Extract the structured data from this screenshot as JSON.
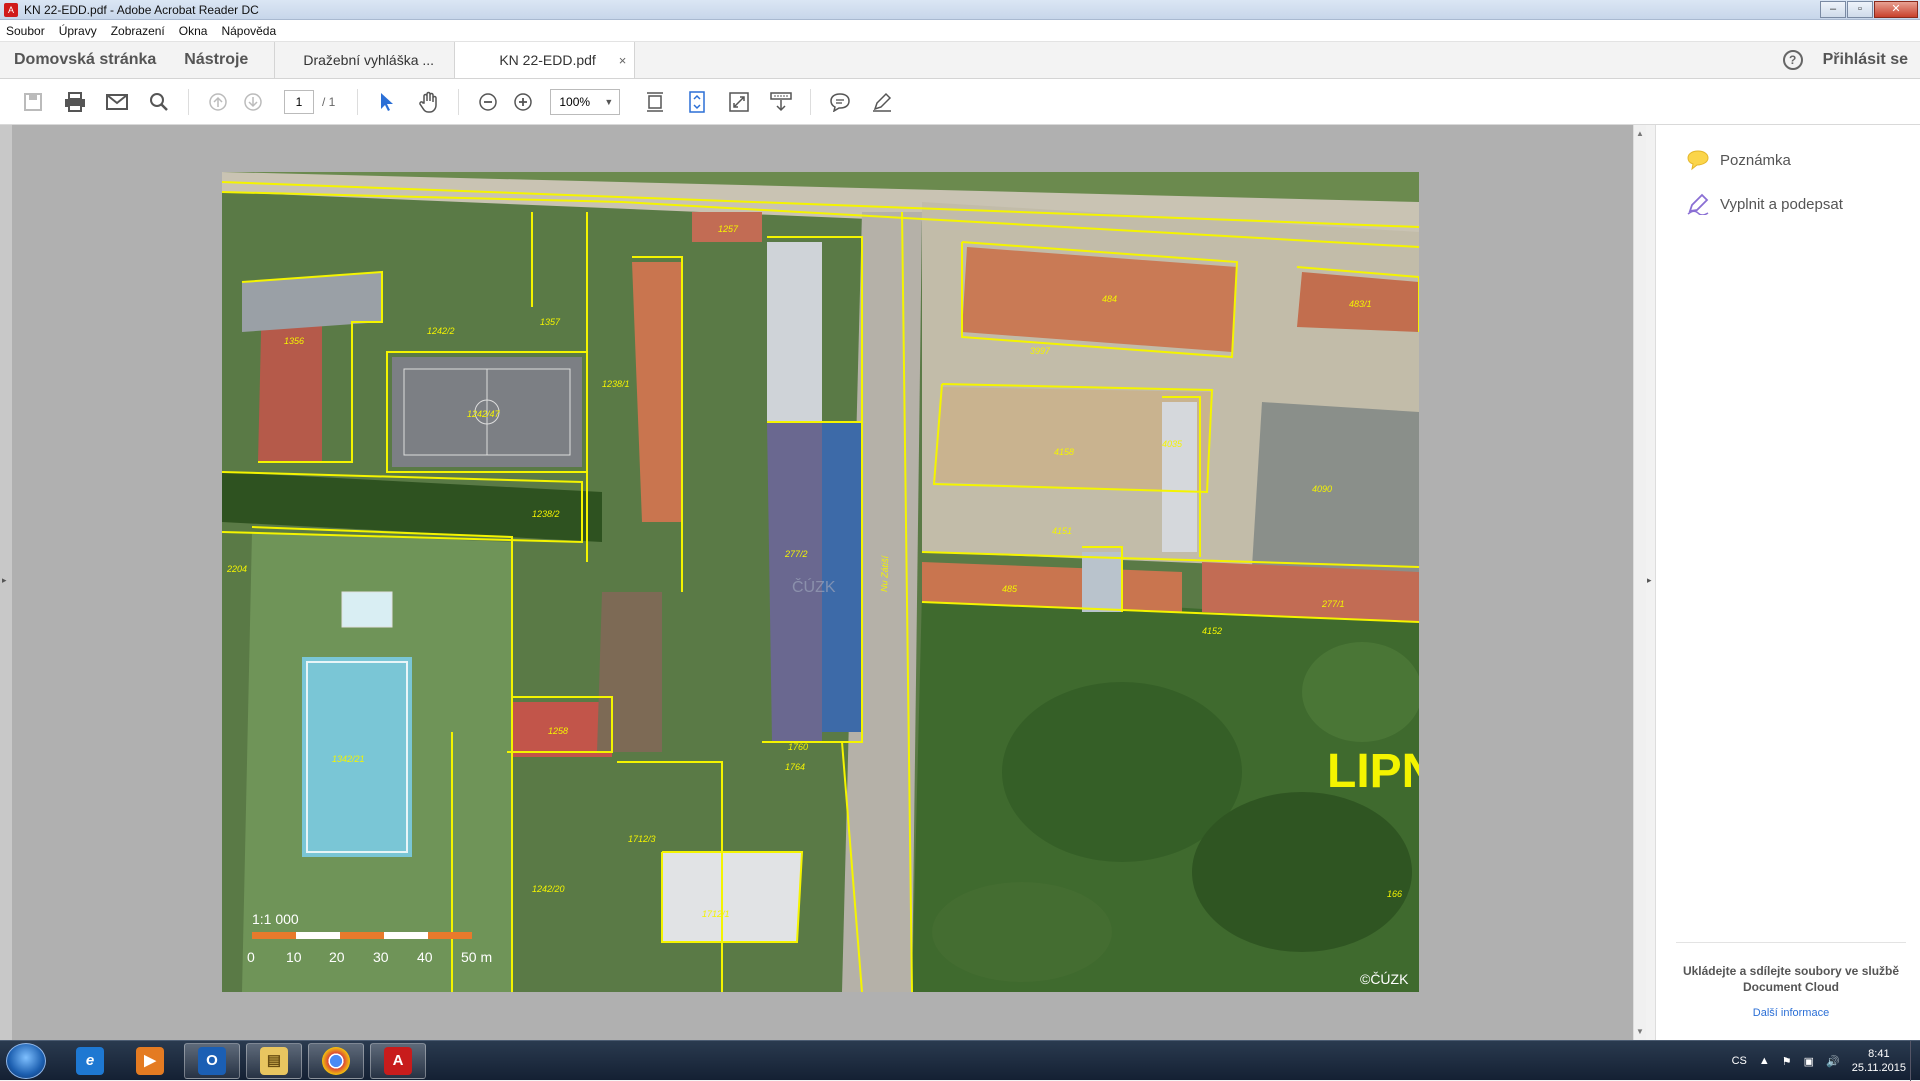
{
  "window": {
    "title": "KN 22-EDD.pdf - Adobe Acrobat Reader DC"
  },
  "menu": [
    "Soubor",
    "Úpravy",
    "Zobrazení",
    "Okna",
    "Nápověda"
  ],
  "nav": {
    "home": "Domovská stránka",
    "tools": "Nástroje"
  },
  "tabs": [
    {
      "label": "Dražební vyhláška ..."
    },
    {
      "label": "KN 22-EDD.pdf",
      "close": "×"
    }
  ],
  "header": {
    "help": "?",
    "signin": "Přihlásit se"
  },
  "toolbar": {
    "page_current": "1",
    "page_total": "/ 1",
    "zoom": "100%"
  },
  "map": {
    "parcels": [
      "1257",
      "1242/2",
      "1357",
      "1356",
      "1242/47",
      "1238/1",
      "1238/2",
      "2204",
      "484",
      "483/1",
      "3997",
      "4158",
      "4035",
      "4090",
      "4151",
      "485",
      "277/1",
      "4152",
      "277/2",
      "1258",
      "1342/21",
      "1712/3",
      "1242/20",
      "1760",
      "1764",
      "166",
      "1712/1",
      "Nu Zátiší"
    ],
    "place_label": "LIPN",
    "watermark": "ČÚZK",
    "copyright": "©ČÚZK",
    "scale_text": "1:1 000",
    "scale_ticks": [
      "0",
      "10",
      "20",
      "30",
      "40",
      "50 m"
    ]
  },
  "rightpanel": {
    "items": [
      "Poznámka",
      "Vyplnit a podepsat"
    ],
    "promo": "Ukládejte a sdílejte soubory ve službě Document Cloud",
    "link": "Další informace"
  },
  "taskbar": {
    "lang": "CS",
    "time": "8:41",
    "date": "25.11.2015"
  }
}
